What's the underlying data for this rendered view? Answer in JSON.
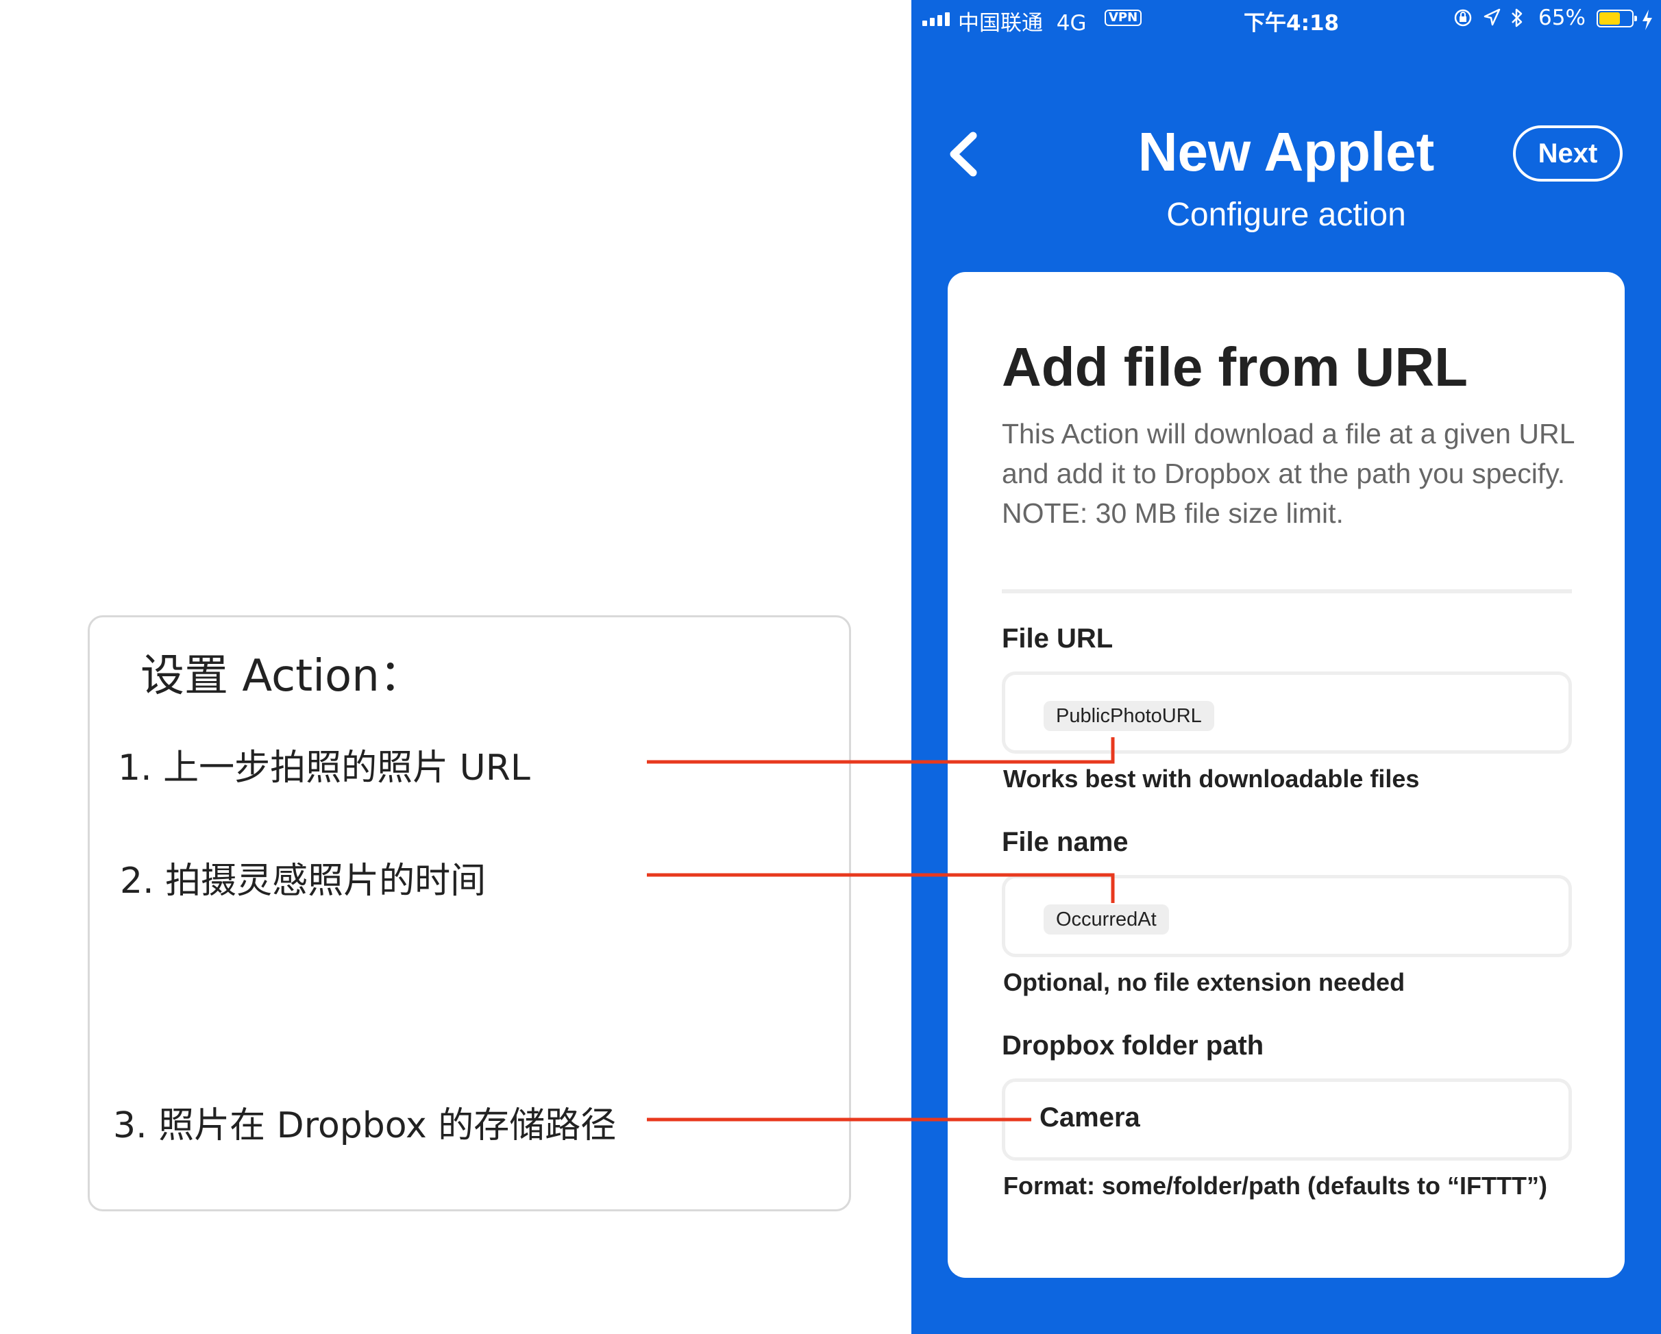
{
  "annotation": {
    "title": "设置 Action：",
    "items": [
      "1. 上一步拍照的照片 URL",
      "2. 拍摄灵感照片的时间",
      "3. 照片在 Dropbox 的存储路径"
    ],
    "line_color": "#e8391e"
  },
  "status_bar": {
    "carrier": "中国联通",
    "network": "4G",
    "vpn": "VPN",
    "time": "下午4:18",
    "battery_percent_text": "65%",
    "battery_level": 0.65,
    "icons": [
      "signal-icon",
      "lock-rotation-icon",
      "location-icon",
      "bluetooth-icon",
      "battery-icon",
      "charging-icon"
    ]
  },
  "nav": {
    "title": "New Applet",
    "subtitle": "Configure action",
    "next_label": "Next",
    "back_icon": "chevron-left-icon"
  },
  "card": {
    "title": "Add file from URL",
    "description": "This Action will download a file at a given URL and add it to Dropbox at the path you specify. NOTE: 30 MB file size limit."
  },
  "fields": [
    {
      "label": "File URL",
      "ingredient": "PublicPhotoURL",
      "help": "Works best with downloadable files"
    },
    {
      "label": "File name",
      "ingredient": "OccurredAt",
      "help": "Optional, no file extension needed"
    },
    {
      "label": "Dropbox folder path",
      "value": "Camera",
      "help": "Format: some/folder/path (defaults to “IFTTT”)"
    }
  ],
  "colors": {
    "brand_blue": "#0d66e0",
    "battery_yellow": "#ffd60a",
    "card_bg": "#ffffff"
  }
}
